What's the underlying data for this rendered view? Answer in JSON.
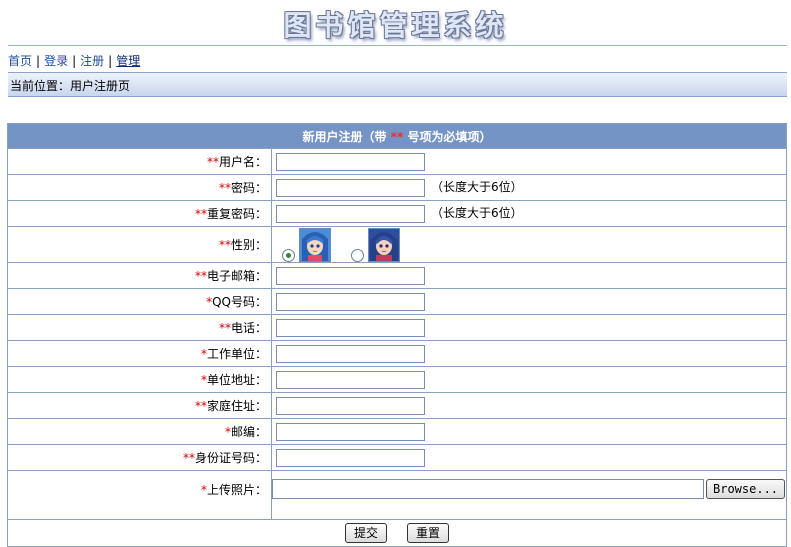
{
  "app": {
    "title": "图书馆管理系统"
  },
  "nav": {
    "items": [
      "首页",
      "登录",
      "注册",
      "管理"
    ]
  },
  "breadcrumb": {
    "text": "当前位置：用户注册页"
  },
  "form": {
    "header_prefix": "新用户注册（带 ",
    "header_stars": "**",
    "header_suffix": " 号项为必填项）",
    "fields": [
      {
        "star": "**",
        "label": "用户名：",
        "value": ""
      },
      {
        "star": "**",
        "label": "密码：",
        "value": "",
        "hint": "（长度大于6位）"
      },
      {
        "star": "**",
        "label": "重复密码：",
        "value": "",
        "hint": "（长度大于6位）"
      },
      {
        "star": "**",
        "label": "性别："
      },
      {
        "star": "**",
        "label": "电子邮箱：",
        "value": ""
      },
      {
        "star": "*",
        "label": "QQ号码：",
        "value": ""
      },
      {
        "star": "**",
        "label": "电话：",
        "value": ""
      },
      {
        "star": "*",
        "label": "工作单位：",
        "value": ""
      },
      {
        "star": "*",
        "label": "单位地址：",
        "value": ""
      },
      {
        "star": "**",
        "label": "家庭住址：",
        "value": ""
      },
      {
        "star": "*",
        "label": "邮编：",
        "value": ""
      },
      {
        "star": "**",
        "label": "身份证号码：",
        "value": ""
      },
      {
        "star": "*",
        "label": "上传照片："
      }
    ],
    "gender": {
      "selected": "female-a",
      "options": [
        "avatar-a",
        "avatar-b"
      ]
    },
    "browse_label": "Browse...",
    "submit_label": "提交",
    "reset_label": "重置"
  },
  "colors": {
    "accent": "#6b8cc0",
    "link": "#1f4e9a",
    "required": "#d40000"
  }
}
